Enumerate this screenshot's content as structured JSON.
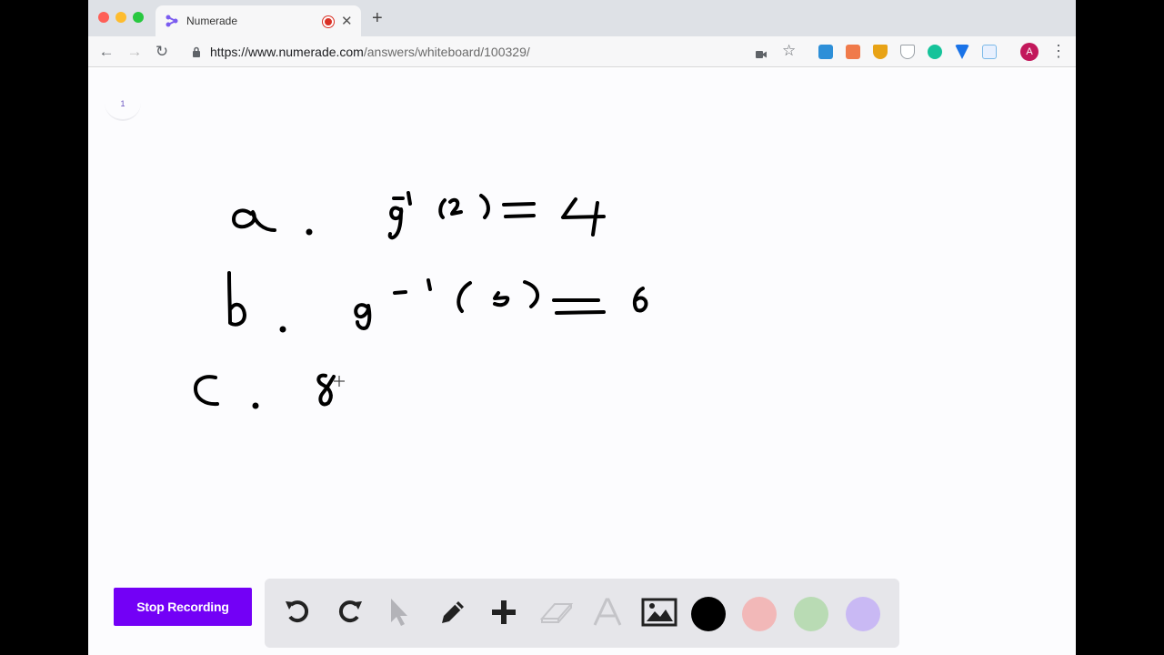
{
  "browser": {
    "tab_title": "Numerade",
    "url_host": "https://www.numerade.com",
    "url_path": "/answers/whiteboard/100329/",
    "avatar_initial": "A"
  },
  "whiteboard": {
    "page_number": "1",
    "stop_recording_label": "Stop Recording",
    "colors": {
      "accent": "#7300f6",
      "black": "#000000",
      "red": "#f2b8b8",
      "green": "#b9dbb4",
      "purple": "#c9b9f4"
    }
  }
}
